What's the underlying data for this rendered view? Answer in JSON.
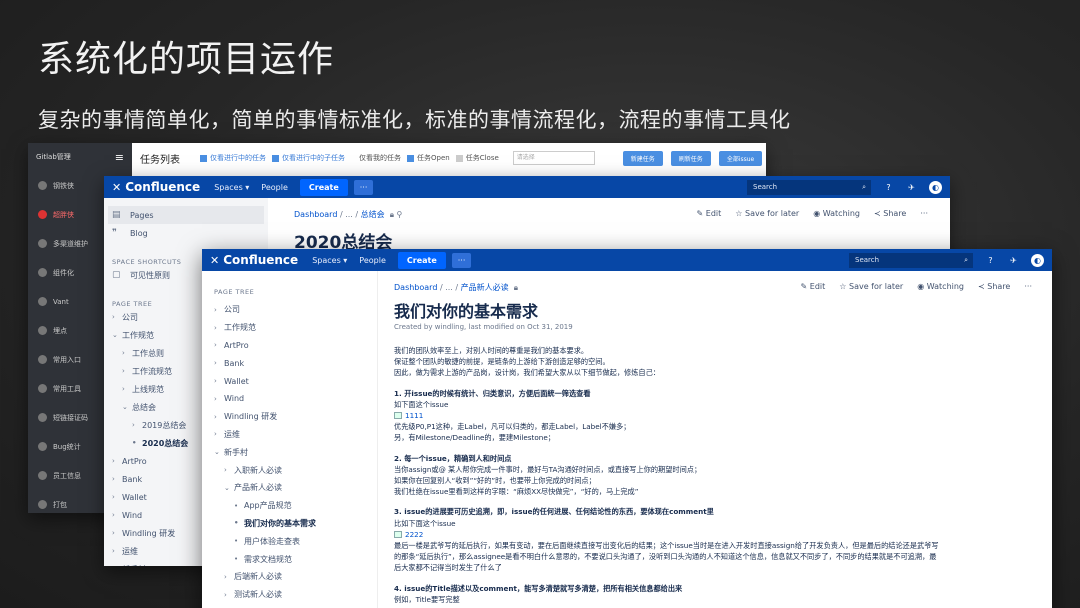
{
  "slide": {
    "title": "系统化的项目运作",
    "subtitle": "复杂的事情简单化，简单的事情标准化，标准的事情流程化，流程的事情工具化"
  },
  "gitlab": {
    "brand": "Gitlab管理",
    "menu_glyph": "≡",
    "page_title": "任务列表",
    "filters": {
      "f1": "仅看进行中的任务",
      "f2": "仅看进行中的子任务",
      "f3": "仅看我的任务",
      "f4": "任务Open",
      "f5": "任务Close",
      "select_placeholder": "请选择"
    },
    "buttons": [
      "新建任务",
      "刷新任务",
      "全部issue"
    ],
    "sidebar": [
      "钢铁侠",
      "超胖侠",
      "多渠道维护",
      "组件化",
      "Vant",
      "埋点",
      "常用入口",
      "常用工具",
      "短链接证码",
      "Bug统计",
      "员工信息",
      "打包"
    ]
  },
  "confluence_back": {
    "logo": "Confluence",
    "nav": {
      "spaces": "Spaces ▾",
      "people": "People",
      "create": "Create",
      "more": "···"
    },
    "search_placeholder": "Search",
    "sidebar": {
      "pages": "Pages",
      "blog": "Blog",
      "shortcuts_header": "SPACE SHORTCUTS",
      "shortcut": "可见性原则",
      "tree_header": "PAGE TREE"
    },
    "tree": [
      {
        "arrow": "›",
        "label": "公司",
        "indent": 0
      },
      {
        "arrow": "⌄",
        "label": "工作规范",
        "indent": 0
      },
      {
        "arrow": "›",
        "label": "工作总则",
        "indent": 1
      },
      {
        "arrow": "›",
        "label": "工作流规范",
        "indent": 1
      },
      {
        "arrow": "›",
        "label": "上线规范",
        "indent": 1
      },
      {
        "arrow": "⌄",
        "label": "总结会",
        "indent": 1
      },
      {
        "arrow": "›",
        "label": "2019总结会",
        "indent": 2
      },
      {
        "arrow": "•",
        "label": "2020总结会",
        "indent": 2,
        "bold": true
      },
      {
        "arrow": "›",
        "label": "ArtPro",
        "indent": 0
      },
      {
        "arrow": "›",
        "label": "Bank",
        "indent": 0
      },
      {
        "arrow": "›",
        "label": "Wallet",
        "indent": 0
      },
      {
        "arrow": "›",
        "label": "Wind",
        "indent": 0
      },
      {
        "arrow": "›",
        "label": "Windling 研发",
        "indent": 0
      },
      {
        "arrow": "›",
        "label": "运维",
        "indent": 0
      },
      {
        "arrow": "›",
        "label": "新手村",
        "indent": 0
      }
    ],
    "breadcrumb": {
      "a": "Dashboard",
      "sep": "/ ... /",
      "b": "总结会"
    },
    "actions": {
      "edit": "✎ Edit",
      "save": "☆ Save for later",
      "watch": "◉ Watching",
      "share": "≺ Share",
      "more": "···"
    },
    "page_title": "2020总结会"
  },
  "confluence_front": {
    "logo": "Confluence",
    "nav": {
      "spaces": "Spaces ▾",
      "people": "People",
      "create": "Create",
      "more": "···"
    },
    "search_placeholder": "Search",
    "tree_header": "PAGE TREE",
    "tree": [
      {
        "arrow": "›",
        "label": "公司",
        "indent": 0
      },
      {
        "arrow": "›",
        "label": "工作规范",
        "indent": 0
      },
      {
        "arrow": "›",
        "label": "ArtPro",
        "indent": 0
      },
      {
        "arrow": "›",
        "label": "Bank",
        "indent": 0
      },
      {
        "arrow": "›",
        "label": "Wallet",
        "indent": 0
      },
      {
        "arrow": "›",
        "label": "Wind",
        "indent": 0
      },
      {
        "arrow": "›",
        "label": "Windling 研发",
        "indent": 0
      },
      {
        "arrow": "›",
        "label": "运维",
        "indent": 0
      },
      {
        "arrow": "⌄",
        "label": "新手村",
        "indent": 0
      },
      {
        "arrow": "›",
        "label": "入职新人必读",
        "indent": 1
      },
      {
        "arrow": "⌄",
        "label": "产品新人必读",
        "indent": 1
      },
      {
        "arrow": "•",
        "label": "App产品规范",
        "indent": 2
      },
      {
        "arrow": "•",
        "label": "我们对你的基本需求",
        "indent": 2,
        "bold": true
      },
      {
        "arrow": "•",
        "label": "用户体验走查表",
        "indent": 2
      },
      {
        "arrow": "•",
        "label": "需求文档规范",
        "indent": 2
      },
      {
        "arrow": "›",
        "label": "后端新人必读",
        "indent": 1
      },
      {
        "arrow": "›",
        "label": "测试新人必读",
        "indent": 1
      }
    ],
    "breadcrumb": {
      "a": "Dashboard",
      "sep": "/ ... /",
      "b": "产品新人必读"
    },
    "actions": {
      "edit": "✎ Edit",
      "save": "☆ Save for later",
      "watch": "◉ Watching",
      "share": "≺ Share",
      "more": "···"
    },
    "page_title": "我们对你的基本需求",
    "meta": "Created by windling, last modified on Oct 31, 2019",
    "body": [
      {
        "k": "p",
        "t": "我们的团队效率至上，对别人时间的尊重是我们的基本要求。"
      },
      {
        "k": "p",
        "t": "保证整个团队的敏捷的前提，是链条的上游给下游创造足够的空间。"
      },
      {
        "k": "p",
        "t": "因此，做为需求上游的产品岗，设计岗，我们希望大家从以下细节做起，修炼自己："
      },
      {
        "k": "h",
        "t": "1. 开issue的时候有统计、归类意识，方便后面統一筛选查看"
      },
      {
        "k": "p",
        "t": "如下面这个issue"
      },
      {
        "k": "img",
        "t": "1111"
      },
      {
        "k": "p",
        "t": "优先级P0,P1这种，走Label，凡可以归类的，都走Label，Label不嫌多；"
      },
      {
        "k": "p",
        "t": "另，有Milestone/Deadline的，要建Milestone；"
      },
      {
        "k": "h",
        "t": "2. 每一个issue，精确到人和时间点"
      },
      {
        "k": "p",
        "t": "当你assign或@ 某人帮你完成一件事时，最好与TA沟通好时间点，或直接写上你的期望时间点；"
      },
      {
        "k": "p",
        "t": "如果你在回复别人“收到”“好的”时，也要带上你完成的时间点；"
      },
      {
        "k": "p",
        "t": "我们杜绝在issue里看到这样的字眼：“麻烦XX尽快做完”，“好的，马上完成”"
      },
      {
        "k": "h",
        "t": "3. issue的进展要可历史追溯，即，issue的任何进展、任何结论性的东西，要体现在comment里"
      },
      {
        "k": "p",
        "t": "比如下面这个issue"
      },
      {
        "k": "img",
        "t": "2222"
      },
      {
        "k": "p",
        "t": "最后一楼是武爷写的延后执行，如果有变动，要在后面继续直接写出变化后的结果；这个issue当时是在进入开发时直接assign给了开发负责人，但是最后的结论还是武爷写"
      },
      {
        "k": "p",
        "t": "的那条“延后执行”，那么assignee是看不明白什么意思的，不要说口头沟通了，没听到口头沟通的人不知道这个信息，信息就又不同步了，不同步的结果就是不可追溯，最"
      },
      {
        "k": "p",
        "t": "后大家都不记得当时发生了什么了"
      },
      {
        "k": "h",
        "t": "4. issue的Title描述以及comment，能写多清楚就写多清楚，把所有相关信息都给出来"
      },
      {
        "k": "p",
        "t": "例如，Title要写完整"
      }
    ]
  }
}
